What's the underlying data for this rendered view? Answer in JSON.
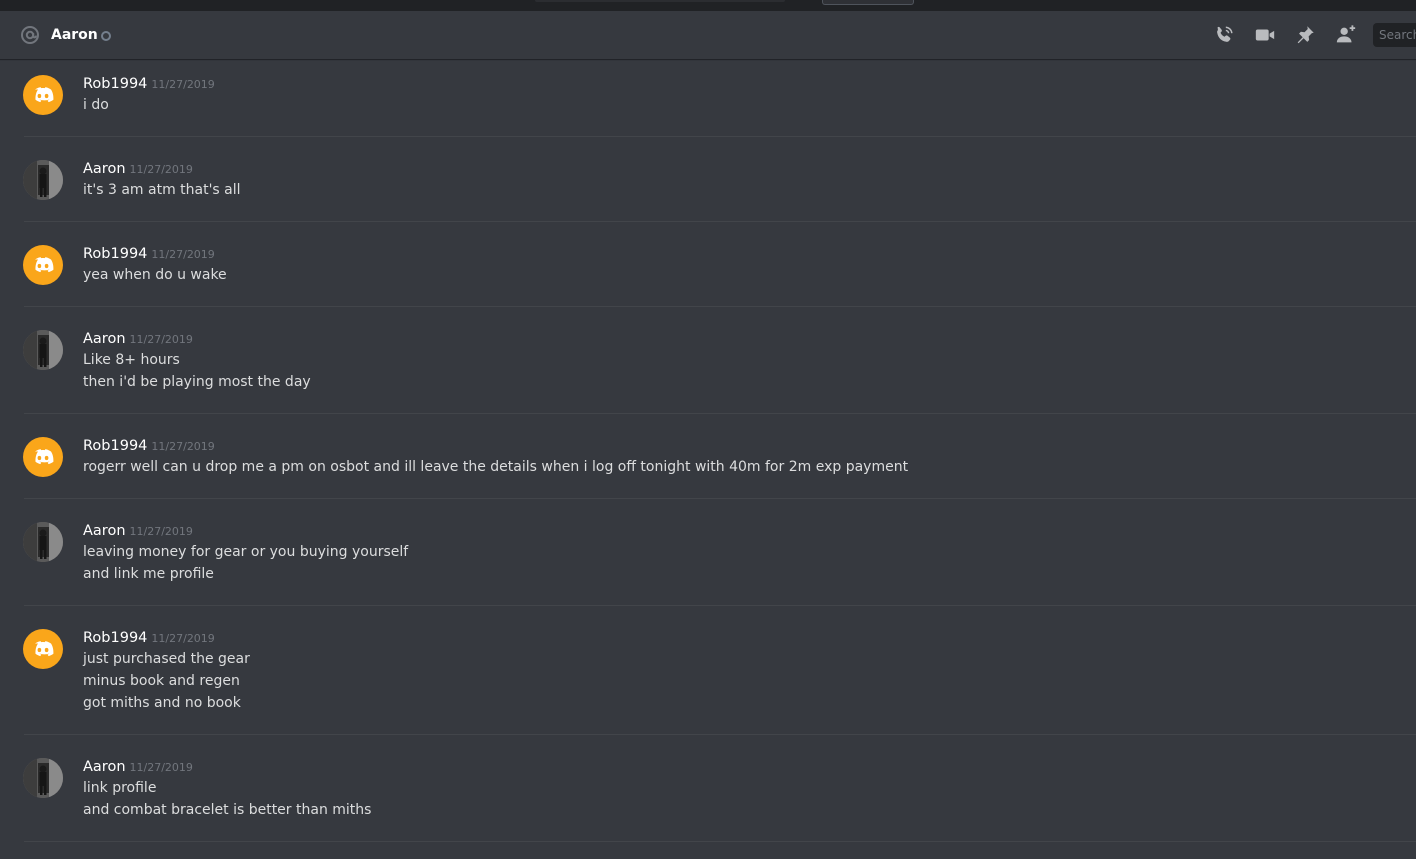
{
  "header": {
    "channel_name": "Aaron",
    "search_placeholder": "Search",
    "icons": [
      "at-icon",
      "call-icon",
      "video-icon",
      "pin-icon",
      "add-friend-icon"
    ]
  },
  "colors": {
    "background": "#36393f",
    "bot_avatar": "#faa61a",
    "timestamp": "#72767d"
  },
  "messages": [
    {
      "author": "Rob1994",
      "timestamp": "11/27/2019",
      "avatar": "discord-logo",
      "lines": [
        "i do"
      ]
    },
    {
      "author": "Aaron",
      "timestamp": "11/27/2019",
      "avatar": "photo",
      "lines": [
        "it's 3 am atm that's all"
      ]
    },
    {
      "author": "Rob1994",
      "timestamp": "11/27/2019",
      "avatar": "discord-logo",
      "lines": [
        "yea when do u wake"
      ]
    },
    {
      "author": "Aaron",
      "timestamp": "11/27/2019",
      "avatar": "photo",
      "lines": [
        "Like 8+ hours",
        "then i'd be playing most the day"
      ]
    },
    {
      "author": "Rob1994",
      "timestamp": "11/27/2019",
      "avatar": "discord-logo",
      "lines": [
        "rogerr well can u drop me a pm on osbot and ill leave the details when i log off tonight with 40m for 2m exp payment"
      ]
    },
    {
      "author": "Aaron",
      "timestamp": "11/27/2019",
      "avatar": "photo",
      "lines": [
        "leaving money for gear or you buying yourself",
        "and link me profile"
      ]
    },
    {
      "author": "Rob1994",
      "timestamp": "11/27/2019",
      "avatar": "discord-logo",
      "lines": [
        "just purchased the gear",
        "minus book and regen",
        "got miths and no book"
      ]
    },
    {
      "author": "Aaron",
      "timestamp": "11/27/2019",
      "avatar": "photo",
      "lines": [
        "link profile",
        "and combat bracelet is better than miths"
      ]
    }
  ]
}
